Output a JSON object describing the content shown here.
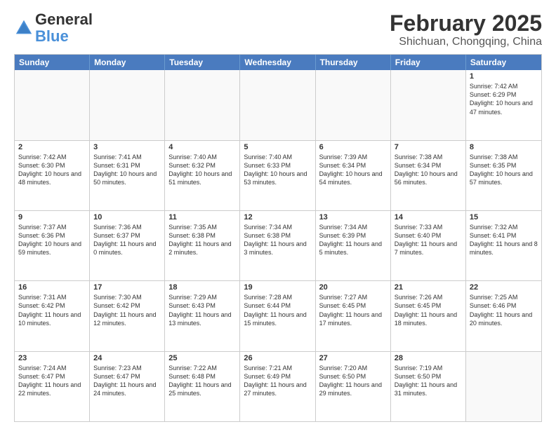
{
  "logo": {
    "line1": "General",
    "line2": "Blue"
  },
  "title": "February 2025",
  "subtitle": "Shichuan, Chongqing, China",
  "header_days": [
    "Sunday",
    "Monday",
    "Tuesday",
    "Wednesday",
    "Thursday",
    "Friday",
    "Saturday"
  ],
  "weeks": [
    [
      {
        "day": "",
        "info": "",
        "empty": true
      },
      {
        "day": "",
        "info": "",
        "empty": true
      },
      {
        "day": "",
        "info": "",
        "empty": true
      },
      {
        "day": "",
        "info": "",
        "empty": true
      },
      {
        "day": "",
        "info": "",
        "empty": true
      },
      {
        "day": "",
        "info": "",
        "empty": true
      },
      {
        "day": "1",
        "info": "Sunrise: 7:42 AM\nSunset: 6:29 PM\nDaylight: 10 hours\nand 47 minutes.",
        "empty": false
      }
    ],
    [
      {
        "day": "2",
        "info": "Sunrise: 7:42 AM\nSunset: 6:30 PM\nDaylight: 10 hours\nand 48 minutes.",
        "empty": false
      },
      {
        "day": "3",
        "info": "Sunrise: 7:41 AM\nSunset: 6:31 PM\nDaylight: 10 hours\nand 50 minutes.",
        "empty": false
      },
      {
        "day": "4",
        "info": "Sunrise: 7:40 AM\nSunset: 6:32 PM\nDaylight: 10 hours\nand 51 minutes.",
        "empty": false
      },
      {
        "day": "5",
        "info": "Sunrise: 7:40 AM\nSunset: 6:33 PM\nDaylight: 10 hours\nand 53 minutes.",
        "empty": false
      },
      {
        "day": "6",
        "info": "Sunrise: 7:39 AM\nSunset: 6:34 PM\nDaylight: 10 hours\nand 54 minutes.",
        "empty": false
      },
      {
        "day": "7",
        "info": "Sunrise: 7:38 AM\nSunset: 6:34 PM\nDaylight: 10 hours\nand 56 minutes.",
        "empty": false
      },
      {
        "day": "8",
        "info": "Sunrise: 7:38 AM\nSunset: 6:35 PM\nDaylight: 10 hours\nand 57 minutes.",
        "empty": false
      }
    ],
    [
      {
        "day": "9",
        "info": "Sunrise: 7:37 AM\nSunset: 6:36 PM\nDaylight: 10 hours\nand 59 minutes.",
        "empty": false
      },
      {
        "day": "10",
        "info": "Sunrise: 7:36 AM\nSunset: 6:37 PM\nDaylight: 11 hours\nand 0 minutes.",
        "empty": false
      },
      {
        "day": "11",
        "info": "Sunrise: 7:35 AM\nSunset: 6:38 PM\nDaylight: 11 hours\nand 2 minutes.",
        "empty": false
      },
      {
        "day": "12",
        "info": "Sunrise: 7:34 AM\nSunset: 6:38 PM\nDaylight: 11 hours\nand 3 minutes.",
        "empty": false
      },
      {
        "day": "13",
        "info": "Sunrise: 7:34 AM\nSunset: 6:39 PM\nDaylight: 11 hours\nand 5 minutes.",
        "empty": false
      },
      {
        "day": "14",
        "info": "Sunrise: 7:33 AM\nSunset: 6:40 PM\nDaylight: 11 hours\nand 7 minutes.",
        "empty": false
      },
      {
        "day": "15",
        "info": "Sunrise: 7:32 AM\nSunset: 6:41 PM\nDaylight: 11 hours\nand 8 minutes.",
        "empty": false
      }
    ],
    [
      {
        "day": "16",
        "info": "Sunrise: 7:31 AM\nSunset: 6:42 PM\nDaylight: 11 hours\nand 10 minutes.",
        "empty": false
      },
      {
        "day": "17",
        "info": "Sunrise: 7:30 AM\nSunset: 6:42 PM\nDaylight: 11 hours\nand 12 minutes.",
        "empty": false
      },
      {
        "day": "18",
        "info": "Sunrise: 7:29 AM\nSunset: 6:43 PM\nDaylight: 11 hours\nand 13 minutes.",
        "empty": false
      },
      {
        "day": "19",
        "info": "Sunrise: 7:28 AM\nSunset: 6:44 PM\nDaylight: 11 hours\nand 15 minutes.",
        "empty": false
      },
      {
        "day": "20",
        "info": "Sunrise: 7:27 AM\nSunset: 6:45 PM\nDaylight: 11 hours\nand 17 minutes.",
        "empty": false
      },
      {
        "day": "21",
        "info": "Sunrise: 7:26 AM\nSunset: 6:45 PM\nDaylight: 11 hours\nand 18 minutes.",
        "empty": false
      },
      {
        "day": "22",
        "info": "Sunrise: 7:25 AM\nSunset: 6:46 PM\nDaylight: 11 hours\nand 20 minutes.",
        "empty": false
      }
    ],
    [
      {
        "day": "23",
        "info": "Sunrise: 7:24 AM\nSunset: 6:47 PM\nDaylight: 11 hours\nand 22 minutes.",
        "empty": false
      },
      {
        "day": "24",
        "info": "Sunrise: 7:23 AM\nSunset: 6:47 PM\nDaylight: 11 hours\nand 24 minutes.",
        "empty": false
      },
      {
        "day": "25",
        "info": "Sunrise: 7:22 AM\nSunset: 6:48 PM\nDaylight: 11 hours\nand 25 minutes.",
        "empty": false
      },
      {
        "day": "26",
        "info": "Sunrise: 7:21 AM\nSunset: 6:49 PM\nDaylight: 11 hours\nand 27 minutes.",
        "empty": false
      },
      {
        "day": "27",
        "info": "Sunrise: 7:20 AM\nSunset: 6:50 PM\nDaylight: 11 hours\nand 29 minutes.",
        "empty": false
      },
      {
        "day": "28",
        "info": "Sunrise: 7:19 AM\nSunset: 6:50 PM\nDaylight: 11 hours\nand 31 minutes.",
        "empty": false
      },
      {
        "day": "",
        "info": "",
        "empty": true
      }
    ]
  ]
}
